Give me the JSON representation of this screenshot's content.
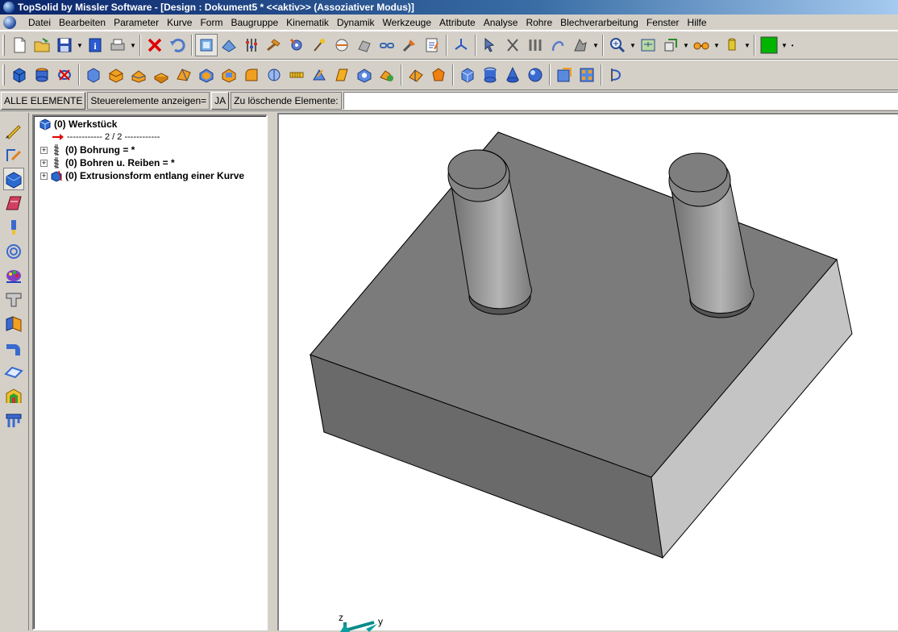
{
  "window": {
    "title": "TopSolid by Missler Software - [Design : Dokument5 *  <<aktiv>> (Assoziativer Modus)]"
  },
  "menu": {
    "items": [
      "Datei",
      "Bearbeiten",
      "Parameter",
      "Kurve",
      "Form",
      "Baugruppe",
      "Kinematik",
      "Dynamik",
      "Werkzeuge",
      "Attribute",
      "Analyse",
      "Rohre",
      "Blechverarbeitung",
      "Fenster",
      "Hilfe"
    ]
  },
  "command_bar": {
    "all_elements_button": "ALLE ELEMENTE",
    "show_controls_label": "Steuerelemente anzeigen=",
    "show_controls_value": "JA",
    "delete_elements_label": "Zu löschende Elemente:",
    "delete_elements_value": ""
  },
  "tree": {
    "root": "(0) Werkstück",
    "separator": "------------ 2 / 2 ------------",
    "items": [
      "(0) Bohrung = *",
      "(0) Bohren u. Reiben = *",
      "(0) Extrusionsform entlang einer Kurve"
    ]
  },
  "viewport": {
    "axis_labels": {
      "z": "z",
      "y": "y"
    }
  },
  "colors": {
    "title_bar": "#0a246a",
    "current_color_swatch": "#00b400",
    "model_top": "#7b7b7b",
    "model_front": "#6a6a6a",
    "model_right": "#c4c4c4"
  }
}
